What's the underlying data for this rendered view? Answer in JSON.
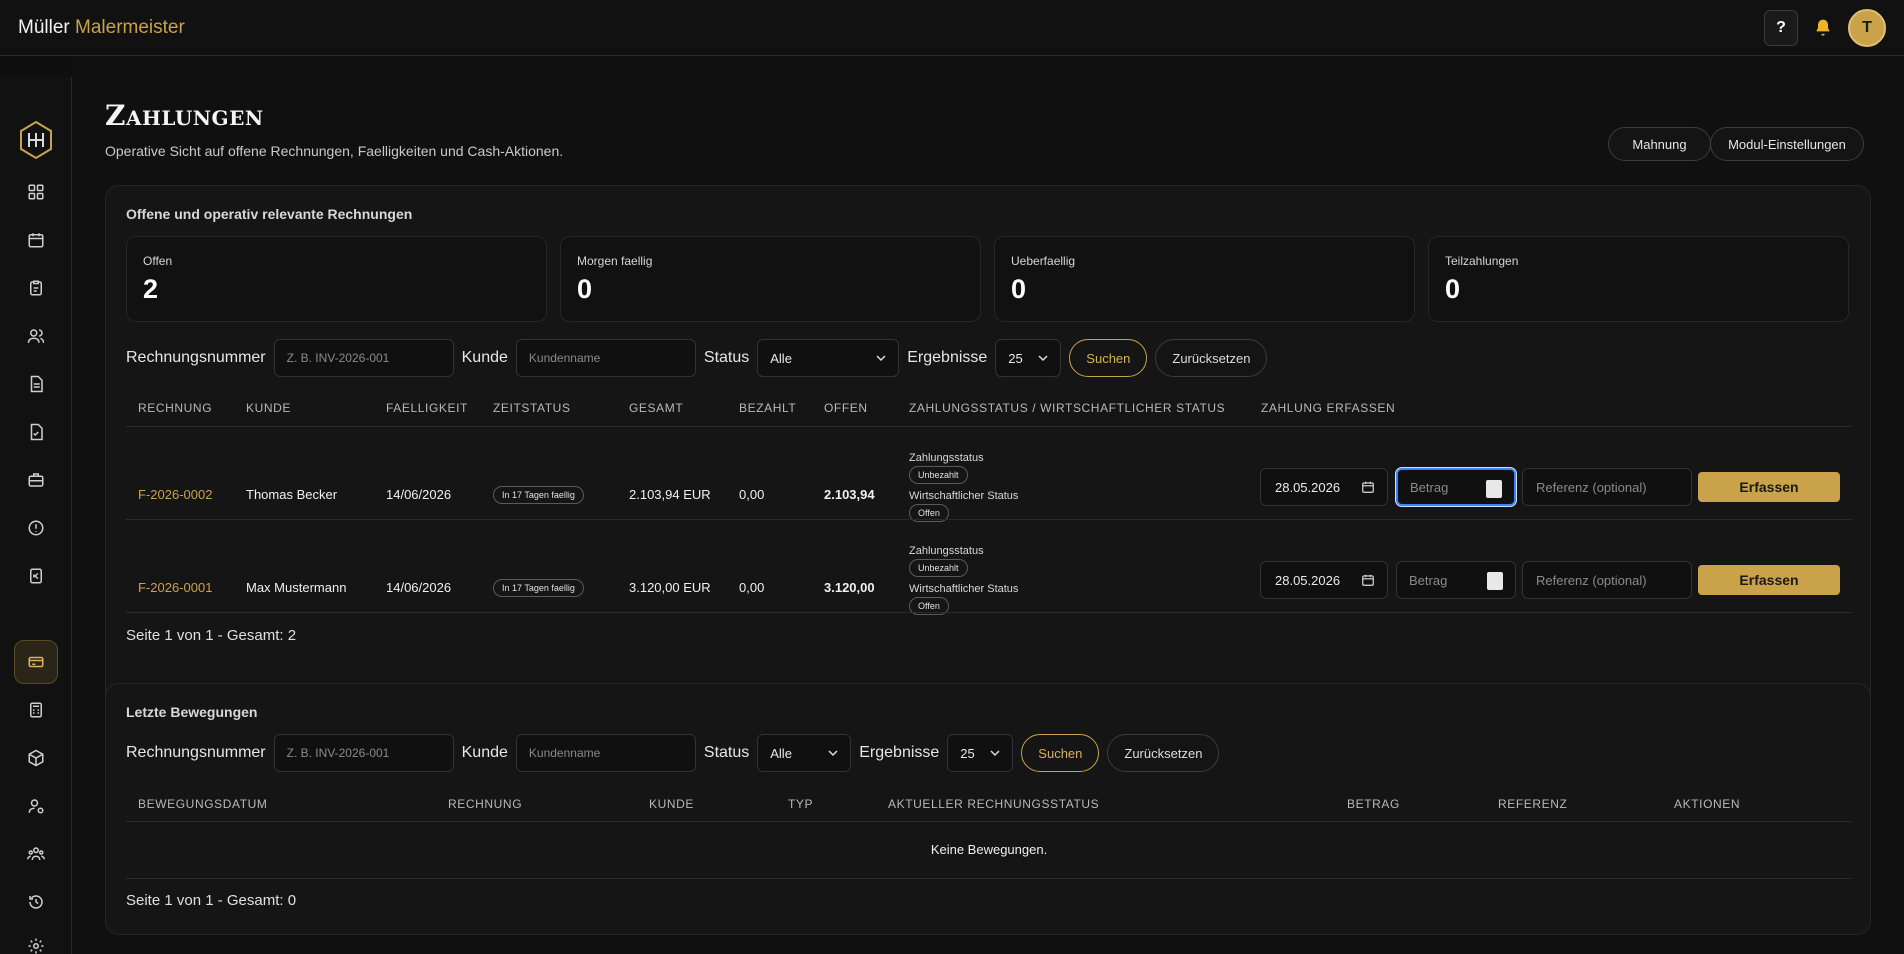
{
  "brand": {
    "name": "Müller",
    "accent": "Malermeister"
  },
  "topbar": {
    "help_label": "?",
    "avatar_initial": "T"
  },
  "page": {
    "title": "Zahlungen",
    "subtitle": "Operative Sicht auf offene Rechnungen, Faelligkeiten und Cash-Aktionen.",
    "buttons": {
      "dunning": "Mahnung",
      "settings": "Modul-Einstellungen"
    }
  },
  "open_panel": {
    "title": "Offene und operativ relevante Rechnungen",
    "stats": [
      {
        "label": "Offen",
        "value": "2"
      },
      {
        "label": "Morgen faellig",
        "value": "0"
      },
      {
        "label": "Ueberfaellig",
        "value": "0"
      },
      {
        "label": "Teilzahlungen",
        "value": "0"
      }
    ],
    "filters": {
      "invoice_label": "Rechnungsnummer",
      "invoice_placeholder": "Z. B. INV-2026-001",
      "customer_label": "Kunde",
      "customer_placeholder": "Kundenname",
      "status_label": "Status",
      "status_value": "Alle",
      "results_label": "Ergebnisse",
      "results_value": "25",
      "search": "Suchen",
      "reset": "Zurücksetzen"
    },
    "columns": [
      "Rechnung",
      "Kunde",
      "Faelligkeit",
      "Zeitstatus",
      "Gesamt",
      "Bezahlt",
      "Offen",
      "Zahlungsstatus / Wirtschaftlicher Status",
      "Zahlung erfassen"
    ],
    "rows": [
      {
        "invoice": "F-2026-0002",
        "customer": "Thomas Becker",
        "due": "14/06/2026",
        "time_status": "In 17 Tagen faellig",
        "total": "2.103,94 EUR",
        "paid": "0,00",
        "open": "2.103,94",
        "payment_status_label": "Zahlungsstatus",
        "payment_status": "Unbezahlt",
        "econ_status_label": "Wirtschaftlicher Status",
        "econ_status": "Offen",
        "date": "28.05.2026",
        "amount_placeholder": "Betrag",
        "ref_placeholder": "Referenz (optional)",
        "action": "Erfassen"
      },
      {
        "invoice": "F-2026-0001",
        "customer": "Max Mustermann",
        "due": "14/06/2026",
        "time_status": "In 17 Tagen faellig",
        "total": "3.120,00 EUR",
        "paid": "0,00",
        "open": "3.120,00",
        "payment_status_label": "Zahlungsstatus",
        "payment_status": "Unbezahlt",
        "econ_status_label": "Wirtschaftlicher Status",
        "econ_status": "Offen",
        "date": "28.05.2026",
        "amount_placeholder": "Betrag",
        "ref_placeholder": "Referenz (optional)",
        "action": "Erfassen"
      }
    ],
    "pagination": "Seite 1 von 1 - Gesamt: 2"
  },
  "movements_panel": {
    "title": "Letzte Bewegungen",
    "filters": {
      "invoice_label": "Rechnungsnummer",
      "invoice_placeholder": "Z. B. INV-2026-001",
      "customer_label": "Kunde",
      "customer_placeholder": "Kundenname",
      "status_label": "Status",
      "status_value": "Alle",
      "results_label": "Ergebnisse",
      "results_value": "25",
      "search": "Suchen",
      "reset": "Zurücksetzen"
    },
    "columns": [
      "Bewegungsdatum",
      "Rechnung",
      "Kunde",
      "Typ",
      "Aktueller Rechnungsstatus",
      "Betrag",
      "Referenz",
      "Aktionen"
    ],
    "empty": "Keine Bewegungen.",
    "pagination": "Seite 1 von 1 - Gesamt: 0"
  },
  "sidebar": {
    "items": [
      "dashboard-icon",
      "calendar-icon",
      "clipboard-icon",
      "users-icon",
      "document-icon",
      "document-check-icon",
      "briefcase-icon",
      "alert-icon",
      "euro-icon",
      "payments-icon",
      "calculator-icon",
      "box-icon",
      "user-settings-icon",
      "team-icon",
      "history-icon",
      "settings-icon"
    ],
    "active": "payments-icon"
  },
  "colors": {
    "accent": "#c9a24a",
    "background": "#0f0f10",
    "panel": "#151516"
  }
}
